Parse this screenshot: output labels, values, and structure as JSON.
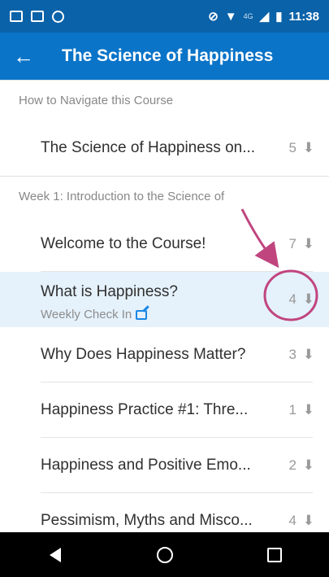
{
  "status_bar": {
    "time": "11:38",
    "network": "4G"
  },
  "toolbar": {
    "title": "The Science of Happiness"
  },
  "sections": [
    {
      "title": "How to Navigate this Course",
      "items": [
        {
          "label": "The Science of Happiness on...",
          "count": "5"
        }
      ]
    },
    {
      "title": "Week 1: Introduction to the Science of",
      "items": [
        {
          "label": "Welcome to the Course!",
          "count": "7"
        },
        {
          "label": "What is Happiness?",
          "subtitle": "Weekly Check In",
          "count": "4"
        },
        {
          "label": "Why Does Happiness Matter?",
          "count": "3"
        },
        {
          "label": "Happiness Practice #1: Thre...",
          "count": "1"
        },
        {
          "label": "Happiness and Positive Emo...",
          "count": "2"
        },
        {
          "label": "Pessimism, Myths and Misco...",
          "count": "4"
        }
      ]
    }
  ],
  "colors": {
    "status_bar": "#0a62a9",
    "toolbar": "#0a74c8",
    "selected_row": "#e5f1fb",
    "annotation": "#c0457f"
  }
}
